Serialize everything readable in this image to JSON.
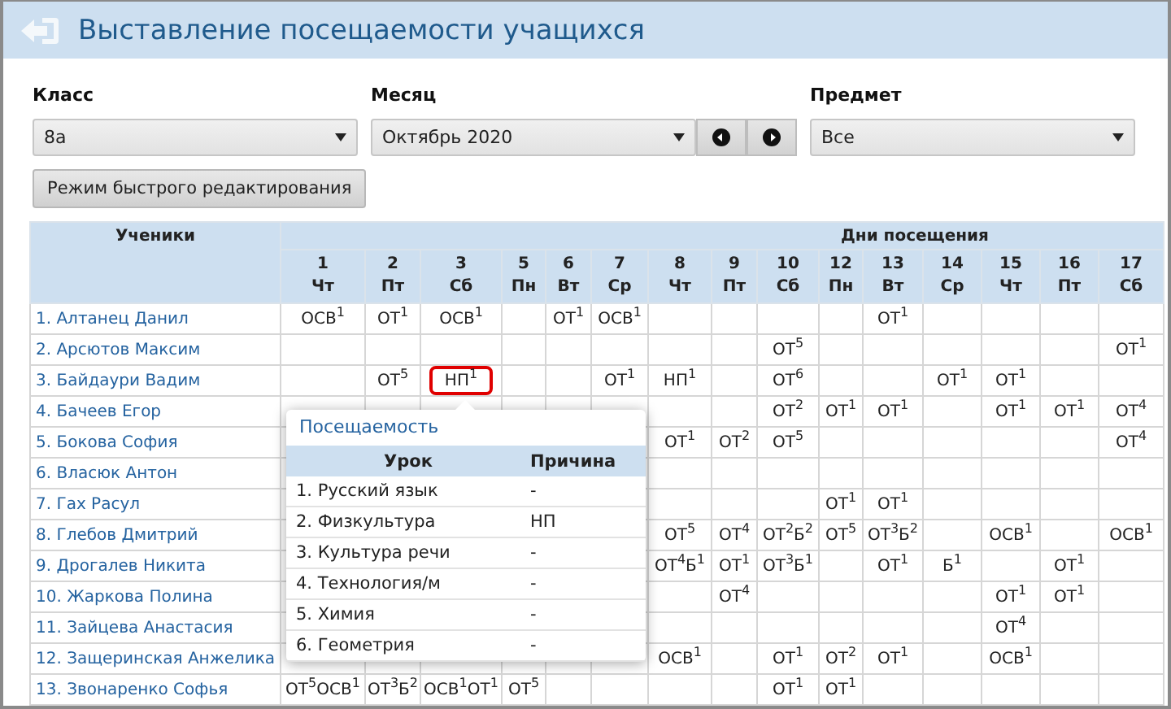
{
  "window": {
    "title": "Выставление посещаемости учащихся"
  },
  "filters": [
    {
      "label": "Класс",
      "value": "8а",
      "kind": "select"
    },
    {
      "label": "Месяц",
      "value": "Октябрь 2020",
      "kind": "month"
    },
    {
      "label": "Предмет",
      "value": "Все",
      "kind": "select"
    }
  ],
  "quick_edit_button": "Режим быстрого редактирования",
  "table": {
    "students_header": "Ученики",
    "days_header": "Дни посещения",
    "days": [
      {
        "day": "1",
        "weekday": "Чт"
      },
      {
        "day": "2",
        "weekday": "Пт"
      },
      {
        "day": "3",
        "weekday": "Сб"
      },
      {
        "day": "5",
        "weekday": "Пн"
      },
      {
        "day": "6",
        "weekday": "Вт"
      },
      {
        "day": "7",
        "weekday": "Ср"
      },
      {
        "day": "8",
        "weekday": "Чт"
      },
      {
        "day": "9",
        "weekday": "Пт"
      },
      {
        "day": "10",
        "weekday": "Сб"
      },
      {
        "day": "12",
        "weekday": "Пн"
      },
      {
        "day": "13",
        "weekday": "Вт"
      },
      {
        "day": "14",
        "weekday": "Ср"
      },
      {
        "day": "15",
        "weekday": "Чт"
      },
      {
        "day": "16",
        "weekday": "Пт"
      },
      {
        "day": "17",
        "weekday": "Сб"
      }
    ],
    "rows": [
      {
        "name": "1. Алтанец Данил",
        "cells": [
          "ОСВ$^{1}$",
          "ОТ$^{1}$",
          "ОСВ$^{1}$",
          null,
          "ОТ$^{1}$",
          "ОСВ$^{1}$",
          null,
          null,
          null,
          null,
          "ОТ$^{1}$",
          null,
          null,
          null,
          null
        ]
      },
      {
        "name": "2. Арсютов Максим",
        "cells": [
          null,
          null,
          null,
          null,
          null,
          null,
          null,
          null,
          "ОТ$^{5}$",
          null,
          null,
          null,
          null,
          null,
          "ОТ$^{1}$"
        ]
      },
      {
        "name": "3. Байдаури Вадим",
        "cells": [
          null,
          "ОТ$^{5}$",
          {
            "text": "НП$^{1}$",
            "selected": true
          },
          null,
          null,
          "ОТ$^{1}$",
          "НП$^{1}$",
          null,
          "ОТ$^{6}$",
          null,
          null,
          "ОТ$^{1}$",
          "ОТ$^{1}$",
          null,
          null
        ]
      },
      {
        "name": "4. Бачеев Егор",
        "cells": [
          null,
          null,
          null,
          null,
          null,
          null,
          null,
          null,
          "ОТ$^{2}$",
          "ОТ$^{1}$",
          "ОТ$^{1}$",
          null,
          "ОТ$^{1}$",
          "ОТ$^{1}$",
          "ОТ$^{4}$"
        ]
      },
      {
        "name": "5. Бокова София",
        "cells": [
          null,
          null,
          null,
          null,
          null,
          null,
          "ОТ$^{1}$",
          "ОТ$^{2}$",
          "ОТ$^{5}$",
          null,
          null,
          null,
          null,
          null,
          "ОТ$^{4}$"
        ]
      },
      {
        "name": "6. Власюк Антон",
        "cells": [
          null,
          null,
          null,
          null,
          null,
          null,
          null,
          null,
          null,
          null,
          null,
          null,
          null,
          null,
          null
        ]
      },
      {
        "name": "7. Гах Расул",
        "cells": [
          null,
          null,
          null,
          null,
          null,
          null,
          null,
          null,
          null,
          "ОТ$^{1}$",
          "ОТ$^{1}$",
          null,
          null,
          null,
          null
        ]
      },
      {
        "name": "8. Глебов Дмитрий",
        "cells": [
          null,
          null,
          null,
          null,
          null,
          null,
          "ОТ$^{5}$",
          "ОТ$^{4}$",
          "ОТ$^{2}$Б$^{2}$",
          "ОТ$^{5}$",
          "ОТ$^{3}$Б$^{2}$",
          null,
          "ОСВ$^{1}$",
          null,
          "ОСВ$^{1}$"
        ]
      },
      {
        "name": "9. Дрогалев Никита",
        "cells": [
          null,
          null,
          null,
          null,
          null,
          null,
          "ОТ$^{4}$Б$^{1}$",
          "ОТ$^{1}$",
          "ОТ$^{3}$Б$^{1}$",
          null,
          "ОТ$^{1}$",
          "Б$^{1}$",
          null,
          "ОТ$^{1}$",
          null
        ]
      },
      {
        "name": "10. Жаркова Полина",
        "cells": [
          null,
          null,
          null,
          null,
          null,
          null,
          null,
          "ОТ$^{4}$",
          null,
          null,
          null,
          null,
          "ОТ$^{1}$",
          "ОТ$^{1}$",
          null
        ]
      },
      {
        "name": "11. Зайцева Анастасия",
        "cells": [
          null,
          null,
          null,
          null,
          null,
          null,
          null,
          null,
          null,
          null,
          null,
          null,
          "ОТ$^{4}$",
          null,
          null
        ]
      },
      {
        "name": "12. Защеринская Анжелика",
        "cells": [
          null,
          null,
          null,
          null,
          null,
          null,
          "ОСВ$^{1}$",
          null,
          "ОТ$^{1}$",
          "ОТ$^{2}$",
          "ОТ$^{1}$",
          null,
          "ОСВ$^{1}$",
          null,
          null
        ]
      },
      {
        "name": "13. Звонаренко Софья",
        "cells": [
          "ОТ$^{5}$ОСВ$^{1}$",
          "ОТ$^{3}$Б$^{2}$",
          "ОСВ$^{1}$ОТ$^{1}$",
          "ОТ$^{5}$",
          null,
          null,
          null,
          null,
          "ОТ$^{1}$",
          "ОТ$^{1}$",
          null,
          null,
          null,
          null,
          null
        ]
      }
    ]
  },
  "popup": {
    "title": "Посещаемость",
    "columns": [
      "Урок",
      "Причина"
    ],
    "rows": [
      {
        "lesson": "1. Русский язык",
        "reason": "-"
      },
      {
        "lesson": "2. Физкультура",
        "reason": "НП"
      },
      {
        "lesson": "3. Культура речи",
        "reason": "-"
      },
      {
        "lesson": "4. Технология/м",
        "reason": "-"
      },
      {
        "lesson": "5. Химия",
        "reason": "-"
      },
      {
        "lesson": "6. Геометрия",
        "reason": "-"
      }
    ]
  }
}
